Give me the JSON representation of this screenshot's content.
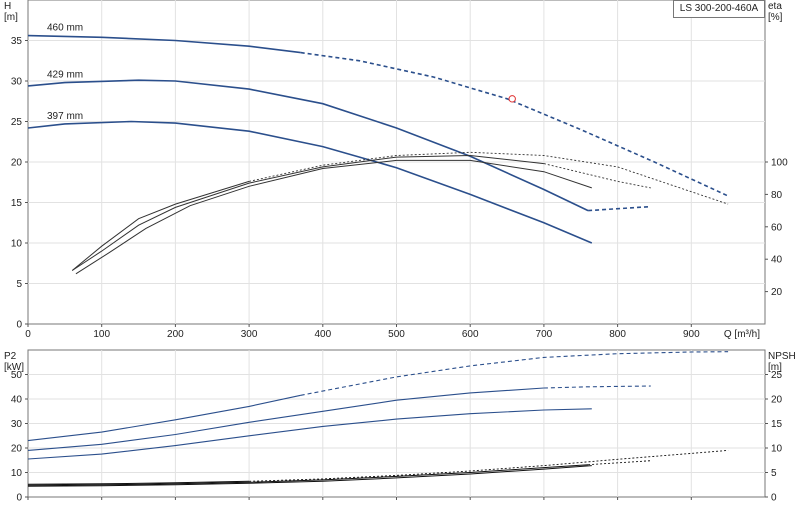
{
  "chart_data": [
    {
      "type": "line",
      "title": "LS 300-200-460A",
      "xlabel": "Q [m³/h]",
      "ylabel_left": "H [m]",
      "ylabel_right": "eta [%]",
      "xlim": [
        0,
        1000
      ],
      "ylim_left": [
        0,
        40
      ],
      "ylim_right": [
        0,
        200
      ],
      "xticks": [
        0,
        100,
        200,
        300,
        400,
        500,
        600,
        700,
        800,
        900
      ],
      "yticks_left": [
        0,
        5,
        10,
        15,
        20,
        25,
        30,
        35
      ],
      "yticks_right": [
        20,
        40,
        60,
        80,
        100
      ],
      "grid": true,
      "series": [
        {
          "name": "460 mm",
          "axis": "left",
          "kind": "head",
          "color": "#2b4f8c",
          "x": [
            0,
            100,
            200,
            300,
            370,
            450,
            550,
            650,
            750,
            850,
            950
          ],
          "y": [
            35.6,
            35.4,
            35.0,
            34.3,
            33.5,
            32.5,
            30.5,
            27.8,
            24.0,
            20.0,
            15.8
          ],
          "solid_until": 370
        },
        {
          "name": "429 mm",
          "axis": "left",
          "kind": "head",
          "color": "#2b4f8c",
          "x": [
            0,
            50,
            150,
            200,
            300,
            400,
            500,
            600,
            700,
            760,
            845
          ],
          "y": [
            29.4,
            29.8,
            30.1,
            30.0,
            29.0,
            27.2,
            24.2,
            20.7,
            16.6,
            14.0,
            14.5
          ],
          "solid_until": 760
        },
        {
          "name": "397 mm",
          "axis": "left",
          "kind": "head",
          "color": "#2b4f8c",
          "x": [
            0,
            50,
            140,
            200,
            300,
            400,
            500,
            600,
            700,
            765
          ],
          "y": [
            24.2,
            24.7,
            25.0,
            24.8,
            23.8,
            21.9,
            19.3,
            16.0,
            12.5,
            10.0
          ],
          "solid_until": 765
        },
        {
          "name": "",
          "axis": "right",
          "kind": "eta",
          "color": "#333333",
          "x": [
            60,
            100,
            150,
            200,
            300,
            400,
            500,
            600,
            700,
            800,
            950
          ],
          "y": [
            33,
            48,
            65,
            74,
            88,
            98,
            104,
            106,
            104,
            97,
            74
          ],
          "solid_until": 370
        },
        {
          "name": "",
          "axis": "right",
          "kind": "eta",
          "color": "#333333",
          "x": [
            60,
            100,
            150,
            200,
            300,
            400,
            500,
            600,
            700,
            800,
            845
          ],
          "y": [
            33,
            45,
            61,
            72,
            87,
            97,
            103,
            104,
            99,
            88,
            84
          ],
          "solid_until": 760
        },
        {
          "name": "",
          "axis": "right",
          "kind": "eta",
          "color": "#333333",
          "x": [
            65,
            110,
            160,
            220,
            300,
            400,
            500,
            600,
            700,
            765
          ],
          "y": [
            31,
            44,
            59,
            73,
            85,
            96,
            101,
            101,
            94,
            84
          ],
          "solid_until": 765
        }
      ],
      "markers": [
        {
          "x": 657,
          "y": 27.8,
          "color": "#e03030",
          "shape": "circle"
        }
      ]
    },
    {
      "type": "line",
      "title": "",
      "xlabel": "",
      "ylabel_left": "P2 [kW]",
      "ylabel_right": "NPSH [m]",
      "xlim": [
        0,
        1000
      ],
      "ylim_left": [
        0,
        60
      ],
      "ylim_right": [
        0,
        30
      ],
      "xticks": [
        0,
        100,
        200,
        300,
        400,
        500,
        600,
        700,
        800,
        900
      ],
      "yticks_left": [
        0,
        10,
        20,
        30,
        40,
        50
      ],
      "yticks_right": [
        0,
        5,
        10,
        15,
        20,
        25
      ],
      "grid": true,
      "series": [
        {
          "name": "",
          "axis": "left",
          "kind": "power",
          "color": "#2b4f8c",
          "x": [
            0,
            100,
            200,
            300,
            370,
            500,
            600,
            700,
            800,
            900,
            950
          ],
          "y": [
            23.0,
            26.5,
            31.5,
            37.0,
            41.5,
            49.0,
            53.5,
            57.0,
            58.5,
            59.2,
            59.3
          ],
          "solid_until": 370
        },
        {
          "name": "",
          "axis": "left",
          "kind": "power",
          "color": "#2b4f8c",
          "x": [
            0,
            100,
            200,
            300,
            400,
            500,
            600,
            700,
            760,
            845
          ],
          "y": [
            19.0,
            21.5,
            25.5,
            30.5,
            35.0,
            39.5,
            42.5,
            44.5,
            45.0,
            45.3
          ],
          "solid_until": 710
        },
        {
          "name": "",
          "axis": "left",
          "kind": "power",
          "color": "#2b4f8c",
          "x": [
            0,
            100,
            200,
            300,
            400,
            500,
            600,
            700,
            765
          ],
          "y": [
            15.5,
            17.5,
            21.0,
            25.0,
            28.8,
            31.8,
            34.0,
            35.5,
            36.0
          ],
          "solid_until": 765
        },
        {
          "name": "",
          "axis": "right",
          "kind": "npsh",
          "color": "#111111",
          "x": [
            0,
            100,
            200,
            300,
            400,
            500,
            600,
            700,
            800,
            900,
            950
          ],
          "y": [
            2.6,
            2.7,
            2.9,
            3.2,
            3.7,
            4.4,
            5.3,
            6.4,
            7.7,
            8.9,
            9.5
          ],
          "solid_until": 370
        },
        {
          "name": "",
          "axis": "right",
          "kind": "npsh",
          "color": "#111111",
          "x": [
            0,
            100,
            200,
            300,
            400,
            500,
            600,
            700,
            760,
            845
          ],
          "y": [
            2.4,
            2.5,
            2.7,
            3.0,
            3.5,
            4.2,
            5.0,
            6.0,
            6.6,
            7.4
          ],
          "solid_until": 760
        },
        {
          "name": "",
          "axis": "right",
          "kind": "npsh",
          "color": "#111111",
          "x": [
            0,
            100,
            200,
            300,
            400,
            500,
            600,
            700,
            765
          ],
          "y": [
            2.2,
            2.3,
            2.5,
            2.8,
            3.2,
            3.9,
            4.7,
            5.7,
            6.4
          ],
          "solid_until": 765
        }
      ],
      "markers": []
    }
  ],
  "labels": {
    "curve_460": "460 mm",
    "curve_429": "429 mm",
    "curve_397": "397 mm",
    "title": "LS 300-200-460A"
  }
}
